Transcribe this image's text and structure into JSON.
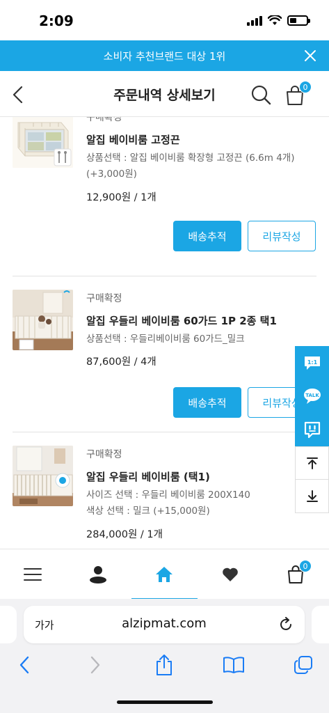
{
  "status_bar": {
    "time": "2:09"
  },
  "banner": {
    "text": "소비자 추천브랜드 대상 1위"
  },
  "header": {
    "title": "주문내역 상세보기",
    "cart_count": "0"
  },
  "orders": [
    {
      "status": "구매확정",
      "name": "알집 베이비룸 고정끈",
      "option_lines": [
        "상품선택 : 알집 베이비룸 확장형 고정끈 (6.6m 4개)",
        "(+3,000원)"
      ],
      "price": "12,900원 / 1개",
      "track_label": "배송추적",
      "review_label": "리뷰작성"
    },
    {
      "status": "구매확정",
      "name": "알집 우들리 베이비룸 60가드 1P 2종 택1",
      "option_lines": [
        "상품선택 : 우들리베이비룸 60가드_밀크"
      ],
      "price": "87,600원 / 4개",
      "track_label": "배송추적",
      "review_label": "리뷰작성"
    },
    {
      "status": "구매확정",
      "name": "알집 우들리 베이비룸 (택1)",
      "option_lines": [
        "사이즈 선택 : 우들리 베이비룸 200X140",
        "색상 선택 : 밀크 (+15,000원)"
      ],
      "price": "284,000원 / 1개"
    }
  ],
  "side_bar": {
    "chat_1to1": "1:1",
    "talk": "TALK"
  },
  "bottom_nav": {
    "cart_count": "0"
  },
  "browser": {
    "aa_label": "가가",
    "url": "alzipmat.com"
  },
  "colors": {
    "accent": "#1ba6e4"
  }
}
